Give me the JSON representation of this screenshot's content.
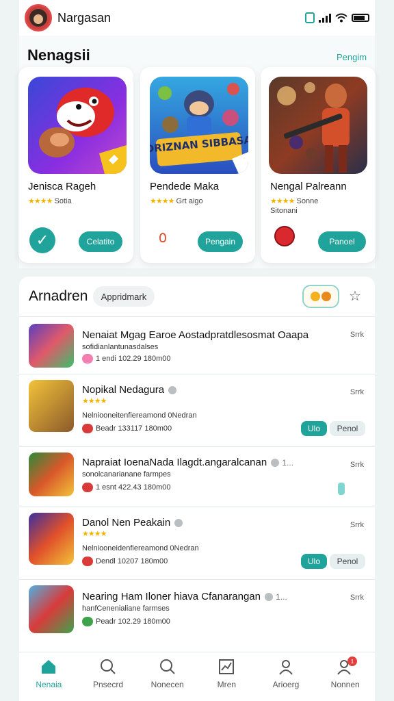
{
  "status_bar": {
    "username": "Nargasan"
  },
  "featured": {
    "title": "Nenagsii",
    "see_all": "Pengim",
    "cards": [
      {
        "name": "Jenisca Rageh",
        "rating": "★★★★",
        "rating_text": "Sotia",
        "sub": "",
        "button": "Celatito"
      },
      {
        "name": "Pendede Maka",
        "rating": "★★★★",
        "rating_text": "Grt aigo",
        "sub": "",
        "art_text": "DRIZNAN SIBBASA",
        "button": "Pengain"
      },
      {
        "name": "Nengal Palreann",
        "rating": "★★★★",
        "rating_text": "Sonne",
        "sub": "Sitonani",
        "button": "Panoel"
      }
    ]
  },
  "list": {
    "title": "Arnadren",
    "filter": "Appridmark",
    "items": [
      {
        "name": "Nenaiat Mgag Earoe Aostadpratdlesosmat Oaapa",
        "sub": "sofidianlantunasdalses",
        "meta": "1 endi 102.29 180m00",
        "size": "Srrk",
        "badge_color": "#f27fb0",
        "has_rating": false,
        "actions": []
      },
      {
        "name": "Nopikal Nedagura",
        "rating": "★★★★",
        "sub": "Nelniooneitenfiereamond 0Nedran",
        "meta": "Beadr 133117 180m00",
        "size": "Srrk",
        "badge_color": "#d93b3b",
        "has_rating": true,
        "actions": [
          "Ulo",
          "Penol"
        ]
      },
      {
        "name": "Napraiat IoenaNada Ilagdt.angaralcanan",
        "sub": "sonolcanarianane farmpes",
        "meta": "1 esnt 422.43 180m00",
        "size": "Srrk",
        "trail": "1...",
        "badge_color": "#d93b3b",
        "has_rating": false,
        "actions": []
      },
      {
        "name": "Danol Nen Peakain",
        "rating": "★★★★",
        "sub": "Nelniooneidenfiereamond 0Nedran",
        "meta": "Dendl 10207 180m00",
        "size": "Srrk",
        "badge_color": "#d93b3b",
        "has_rating": true,
        "actions": [
          "Ulo",
          "Penol"
        ]
      },
      {
        "name": "Nearing Ham Iloner hiava Cfanarangan",
        "sub": "hanfCenenialiane farmses",
        "meta": "Peadr 102.29 180m00",
        "size": "Srrk",
        "trail": "1...",
        "badge_color": "#3fa34d",
        "has_rating": false,
        "actions": []
      }
    ]
  },
  "tabbar": {
    "tabs": [
      {
        "label": "Nenaia",
        "icon": "home-icon",
        "active": true
      },
      {
        "label": "Pnsecrd",
        "icon": "search-icon",
        "active": false
      },
      {
        "label": "Nonecen",
        "icon": "search-icon",
        "active": false
      },
      {
        "label": "Mren",
        "icon": "chart-icon",
        "active": false
      },
      {
        "label": "Arioerg",
        "icon": "user-icon",
        "active": false
      },
      {
        "label": "Nonnen",
        "icon": "users-icon",
        "active": false,
        "notification": "1"
      }
    ]
  },
  "colors": {
    "accent": "#1fa39a",
    "star": "#f0b400",
    "notification": "#e24040"
  }
}
